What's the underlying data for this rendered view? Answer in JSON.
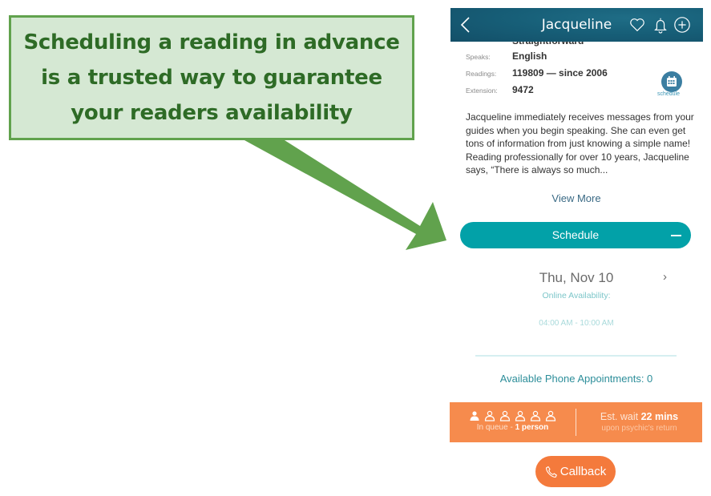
{
  "annotation": {
    "callout_text": "Scheduling a reading in advance\nis a trusted way to guarantee\nyour readers availability",
    "colors": {
      "fill": "#d5e8d3",
      "border": "#61a24d",
      "text": "#2e6b26",
      "arrow": "#61a24d"
    }
  },
  "header": {
    "title": "Jacqueline",
    "icons": [
      "back-chevron-icon",
      "heart-icon",
      "bell-icon",
      "plus-circle-icon"
    ]
  },
  "profile": {
    "partial_hidden_text": "Straightforward",
    "speaks": {
      "label": "Speaks:",
      "value": "English"
    },
    "readings": {
      "label": "Readings:",
      "value": "119809 — since 2006"
    },
    "extension": {
      "label": "Extension:",
      "value": "9472"
    },
    "schedule_shortcut": {
      "label": "schedule",
      "icon": "calendar-icon"
    },
    "bio": "Jacqueline immediately receives messages from your guides when you begin speaking. She can even get tons of information from just knowing a simple name! Reading professionally for over 10 years, Jacqueline says, “There is always so much...",
    "view_more": "View More"
  },
  "schedule": {
    "button_label": "Schedule",
    "collapse_icon": "minus-icon",
    "date": "Thu, Nov 10",
    "next_icon": "chevron-right-icon",
    "online_label": "Online Availability:",
    "time_range": "04:00 AM - 10:00 AM",
    "phone_appointments": "Available Phone Appointments: 0"
  },
  "queue": {
    "total_slots": 6,
    "filled_slots": 1,
    "in_queue_prefix": "In queue - ",
    "in_queue_count": "1 person",
    "wait_prefix": "Est. wait ",
    "wait_value": "22 mins",
    "wait_sub": "upon psychic's return"
  },
  "callback": {
    "label": "Callback",
    "icon": "phone-icon"
  },
  "colors": {
    "header": "#175f78",
    "teal": "#02a1a8",
    "orange_bar": "#f68b4d",
    "callback": "#f47a3c"
  }
}
